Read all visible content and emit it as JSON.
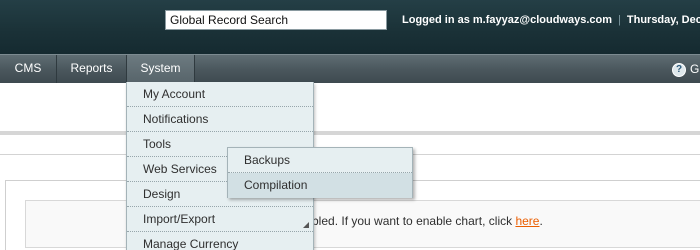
{
  "header": {
    "search_value": "Global Record Search",
    "logged_in": "Logged in as m.fayyaz@cloudways.com",
    "separator": "|",
    "date": "Thursday, Decem"
  },
  "nav": {
    "items": [
      {
        "label": "CMS"
      },
      {
        "label": "Reports"
      },
      {
        "label": "System"
      }
    ],
    "help_label": "G",
    "help_icon": "help-icon"
  },
  "system_menu": {
    "items": [
      {
        "label": "My Account"
      },
      {
        "label": "Notifications"
      },
      {
        "label": "Tools"
      },
      {
        "label": "Web Services"
      },
      {
        "label": "Design"
      },
      {
        "label": "Import/Export"
      },
      {
        "label": "Manage Currency"
      }
    ]
  },
  "tools_submenu": {
    "items": [
      {
        "label": "Backups"
      },
      {
        "label": "Compilation"
      }
    ]
  },
  "dashboard": {
    "notice_text": "bled. If you want to enable chart, click ",
    "notice_link": "here",
    "notice_end": "."
  },
  "colors": {
    "header_bg": "#1b3238",
    "nav_bg": "#4b585e",
    "menu_bg": "#e6eff1",
    "link": "#eb5e00"
  }
}
